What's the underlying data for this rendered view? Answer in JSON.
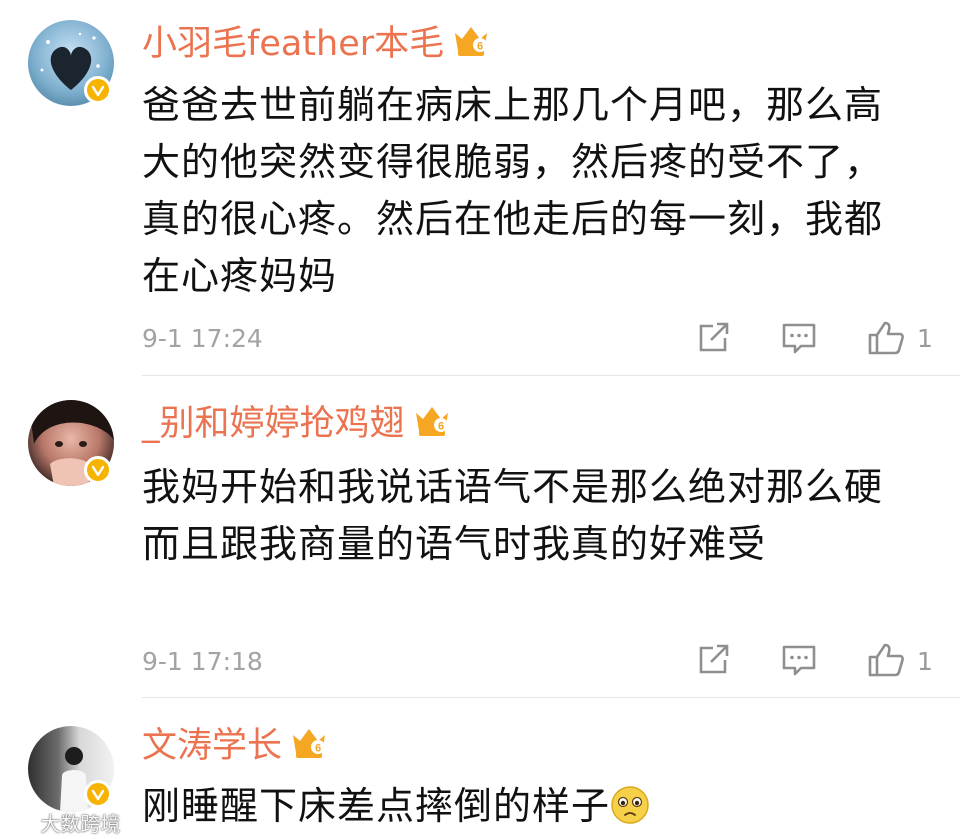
{
  "comments": [
    {
      "username": "小羽毛feather本毛",
      "content": "爸爸去世前躺在病床上那几个月吧，那么高大的他突然变得很脆弱，然后疼的受不了，真的很心疼。然后在他走后的每一刻，我都在心疼妈妈",
      "time": "9-1 17:24",
      "likes": "1",
      "crown_level": "6"
    },
    {
      "username": "_别和婷婷抢鸡翅",
      "content": "我妈开始和我说话语气不是那么绝对那么硬而且跟我商量的语气时我真的好难受",
      "time": "9-1 17:18",
      "likes": "1",
      "crown_level": "6"
    },
    {
      "username": "文涛学长",
      "content": "刚睡醒下床差点摔倒的样子",
      "time": "",
      "likes": "",
      "crown_level": "6"
    }
  ],
  "watermark": "大数跨境",
  "colors": {
    "username": "#eb7350",
    "verified": "#f6b300",
    "crown": "#f5a623",
    "text": "#111111",
    "meta": "#a3a3a3"
  },
  "icons": [
    "verified-badge-icon",
    "crown-icon",
    "repost-icon",
    "comment-icon",
    "like-icon",
    "teary-emoji-icon"
  ]
}
